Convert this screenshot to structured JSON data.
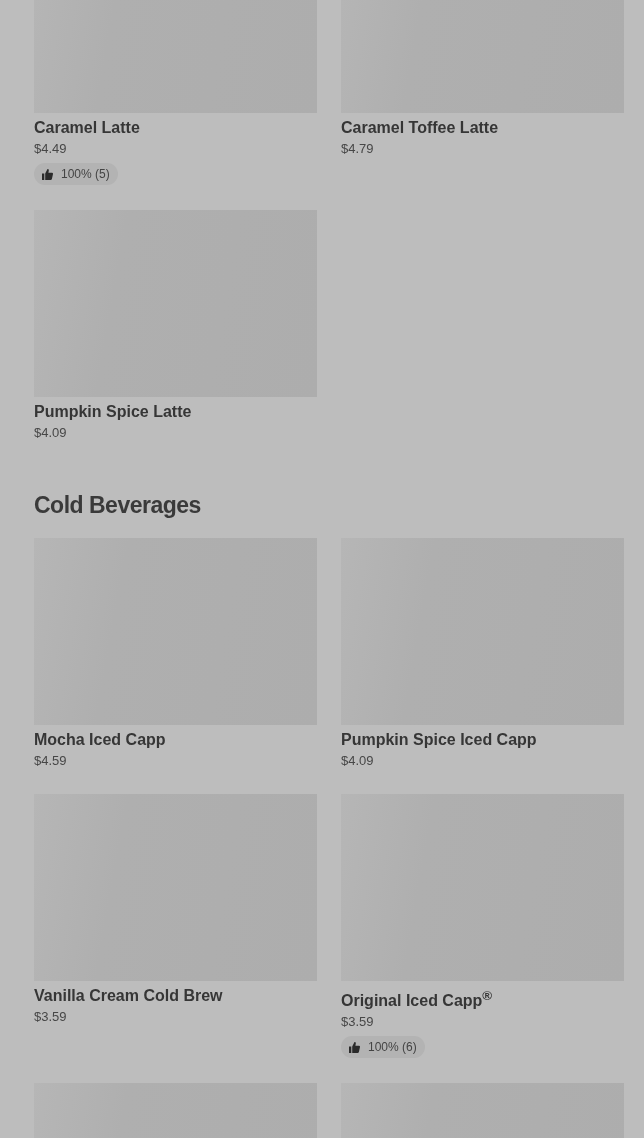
{
  "sections": [
    {
      "items": [
        {
          "kind": "product",
          "name": "Caramel Latte",
          "price": "$4.49",
          "rating": "100% (5)"
        },
        {
          "kind": "product",
          "name": "Caramel Toffee Latte",
          "price": "$4.79"
        },
        {
          "kind": "product",
          "name": "Pumpkin Spice Latte",
          "price": "$4.09"
        }
      ]
    },
    {
      "heading": "Cold Beverages",
      "items": [
        {
          "kind": "product",
          "name": "Mocha Iced Capp",
          "price": "$4.59"
        },
        {
          "kind": "product",
          "name": "Pumpkin Spice Iced Capp",
          "price": "$4.09"
        },
        {
          "kind": "product",
          "name": "Vanilla Cream Cold Brew",
          "price": "$3.59"
        },
        {
          "kind": "product",
          "name": "Original Iced Capp$^{®}$",
          "price": "$3.59",
          "rating": "100% (6)"
        },
        {
          "kind": "image_only"
        },
        {
          "kind": "image_only"
        }
      ]
    }
  ]
}
